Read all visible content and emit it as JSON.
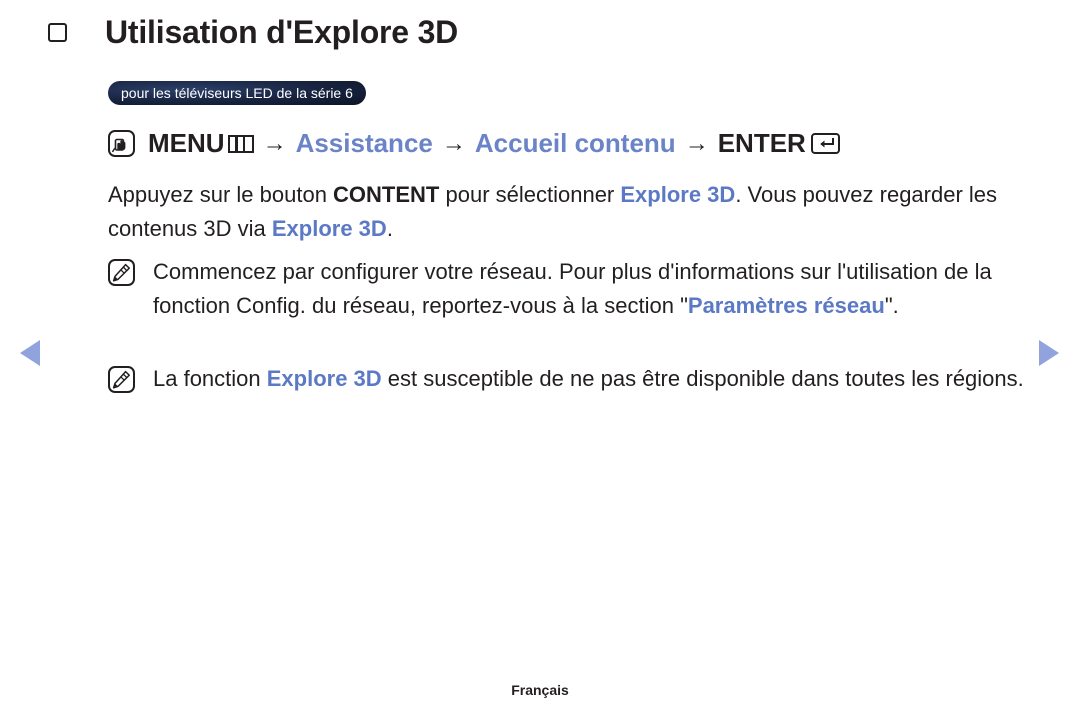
{
  "page": {
    "title": "Utilisation d'Explore 3D",
    "badge": "pour les téléviseurs LED de la série 6",
    "footer": "Français"
  },
  "icons": {
    "title_bullet": "square-bullet-icon",
    "hand_press": "hand-press-icon",
    "menu_grid": "menu-grid-icon",
    "enter_key": "enter-key-icon",
    "note_pencil": "note-pencil-icon",
    "nav_prev": "triangle-left-icon",
    "nav_next": "triangle-right-icon"
  },
  "navpath": {
    "menu_label": "MENU",
    "arrow": "→",
    "step_assistance": "Assistance",
    "step_accueil": "Accueil contenu",
    "enter_label": "ENTER"
  },
  "body": {
    "p1_a": "Appuyez sur le bouton ",
    "p1_content": "CONTENT",
    "p1_b": " pour sélectionner ",
    "p1_explore": "Explore 3D",
    "p1_c": ". Vous pouvez regarder les contenus 3D via ",
    "p1_explore2": "Explore 3D",
    "p1_d": "."
  },
  "notes": [
    {
      "text_a": "Commencez par configurer votre réseau. Pour plus d'informations sur l'utilisation de la fonction Config. du réseau, reportez-vous à la section \"",
      "highlight": "Paramètres réseau",
      "text_b": "\"."
    },
    {
      "text_a": "La fonction ",
      "highlight": "Explore 3D",
      "text_b": " est susceptible de ne pas être disponible dans toutes les régions."
    }
  ],
  "colors": {
    "accent_blue": "#5b79c4",
    "link_blue": "#6b84c8",
    "arrow_blue": "#91a3dd",
    "badge_navy": "#17233f",
    "text": "#231f20"
  }
}
